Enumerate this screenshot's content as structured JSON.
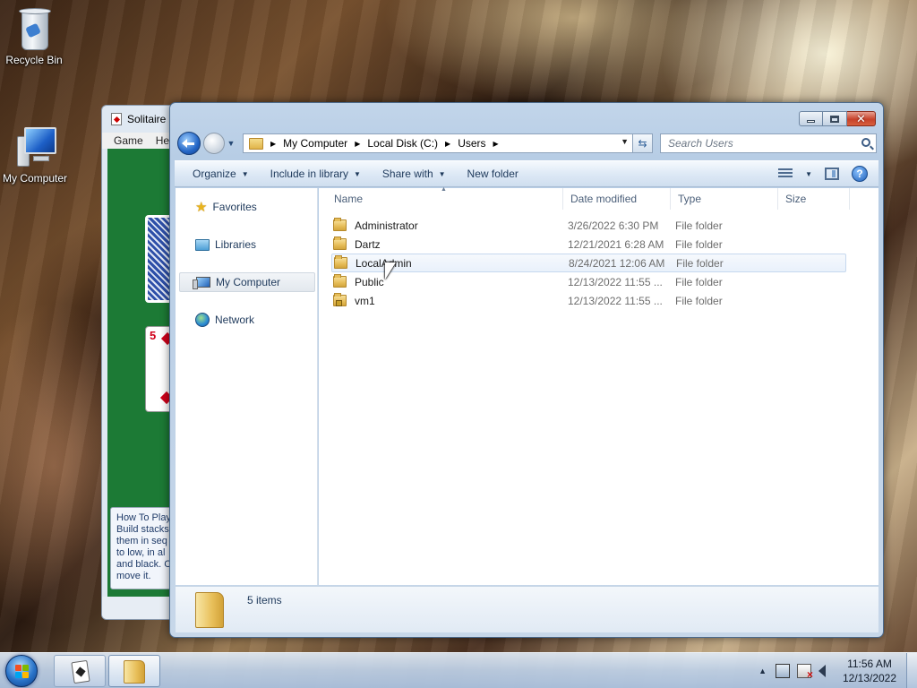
{
  "desktop": {
    "icons": [
      {
        "label": "Recycle Bin",
        "icon": "recycle-bin-icon"
      },
      {
        "label": "My Computer",
        "icon": "my-computer-icon"
      }
    ]
  },
  "solitaire": {
    "title": "Solitaire",
    "menu": [
      "Game",
      "He"
    ],
    "card_rank": "5",
    "help_text": "How To Play\nBuild stacks\nthem in seq\nto low, in al\nand black. C\nmove it."
  },
  "explorer": {
    "address": {
      "crumbs": [
        "My Computer",
        "Local Disk (C:)",
        "Users"
      ]
    },
    "search": {
      "placeholder": "Search Users"
    },
    "commands": {
      "organize": "Organize",
      "include_in_library": "Include in library",
      "share_with": "Share with",
      "new_folder": "New folder"
    },
    "nav": {
      "favorites": "Favorites",
      "libraries": "Libraries",
      "my_computer": "My Computer",
      "network": "Network"
    },
    "columns": {
      "name": "Name",
      "date": "Date modified",
      "type": "Type",
      "size": "Size"
    },
    "files": [
      {
        "name": "Administrator",
        "date": "3/26/2022 6:30 PM",
        "type": "File folder",
        "locked": false
      },
      {
        "name": "Dartz",
        "date": "12/21/2021 6:28 AM",
        "type": "File folder",
        "locked": false
      },
      {
        "name": "LocalAdmin",
        "date": "8/24/2021 12:06 AM",
        "type": "File folder",
        "locked": false
      },
      {
        "name": "Public",
        "date": "12/13/2022 11:55 ...",
        "type": "File folder",
        "locked": false
      },
      {
        "name": "vm1",
        "date": "12/13/2022 11:55 ...",
        "type": "File folder",
        "locked": true
      }
    ],
    "item_count": "5 items"
  },
  "taskbar": {
    "time": "11:56 AM",
    "date": "12/13/2022"
  },
  "colors": {
    "accent": "#1e395b",
    "selection": "#e9f1fb"
  }
}
